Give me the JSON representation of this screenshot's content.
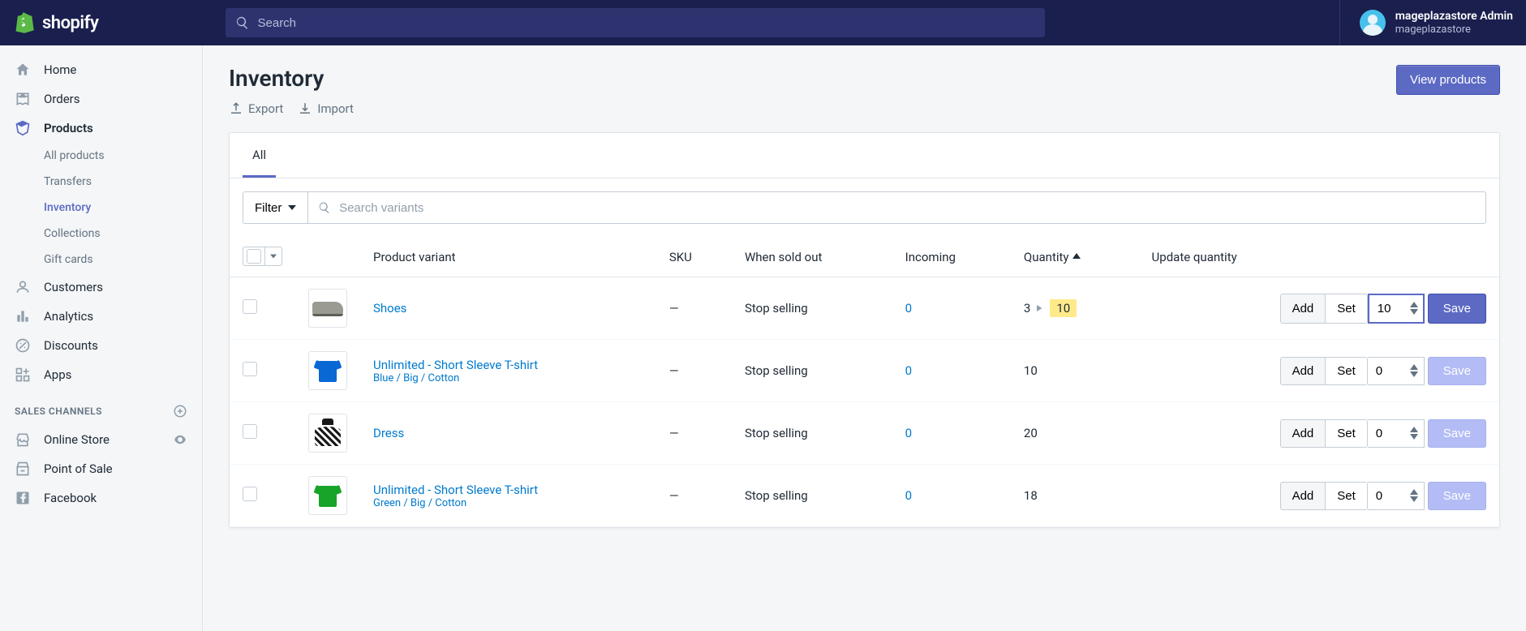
{
  "header": {
    "brand": "shopify",
    "search_placeholder": "Search",
    "user_name": "mageplazastore Admin",
    "user_store": "mageplazastore"
  },
  "sidebar": {
    "main": [
      {
        "label": "Home",
        "icon": "home"
      },
      {
        "label": "Orders",
        "icon": "orders"
      },
      {
        "label": "Products",
        "icon": "products",
        "active": true
      },
      {
        "label": "Customers",
        "icon": "customers"
      },
      {
        "label": "Analytics",
        "icon": "analytics"
      },
      {
        "label": "Discounts",
        "icon": "discounts"
      },
      {
        "label": "Apps",
        "icon": "apps"
      }
    ],
    "products_sub": [
      {
        "label": "All products"
      },
      {
        "label": "Transfers"
      },
      {
        "label": "Inventory",
        "active": true
      },
      {
        "label": "Collections"
      },
      {
        "label": "Gift cards"
      }
    ],
    "channels_header": "SALES CHANNELS",
    "channels": [
      {
        "label": "Online Store",
        "icon": "store",
        "eye": true
      },
      {
        "label": "Point of Sale",
        "icon": "pos"
      },
      {
        "label": "Facebook",
        "icon": "facebook"
      }
    ]
  },
  "page": {
    "title": "Inventory",
    "export": "Export",
    "import": "Import",
    "view_products": "View products",
    "tab_all": "All",
    "filter_label": "Filter",
    "search_variants_placeholder": "Search variants"
  },
  "columns": {
    "product": "Product variant",
    "sku": "SKU",
    "sold_out": "When sold out",
    "incoming": "Incoming",
    "quantity": "Quantity",
    "update": "Update quantity"
  },
  "btns": {
    "add": "Add",
    "set": "Set",
    "save": "Save"
  },
  "rows": [
    {
      "name": "Shoes",
      "sub": "",
      "sku": "—",
      "sold_out": "Stop selling",
      "incoming": "0",
      "qty_old": "3",
      "qty_new": "10",
      "input": "10",
      "focused": true,
      "active_seg": "add",
      "thumb": "shoe"
    },
    {
      "name": "Unlimited - Short Sleeve T-shirt",
      "sub": "Blue / Big / Cotton",
      "sku": "—",
      "sold_out": "Stop selling",
      "incoming": "0",
      "qty": "10",
      "input": "0",
      "active_seg": "add",
      "thumb": "tshirt-blue"
    },
    {
      "name": "Dress",
      "sub": "",
      "sku": "—",
      "sold_out": "Stop selling",
      "incoming": "0",
      "qty": "20",
      "input": "0",
      "active_seg": "add",
      "thumb": "dress"
    },
    {
      "name": "Unlimited - Short Sleeve T-shirt",
      "sub": "Green / Big / Cotton",
      "sku": "—",
      "sold_out": "Stop selling",
      "incoming": "0",
      "qty": "18",
      "input": "0",
      "active_seg": "add",
      "thumb": "tshirt-green"
    }
  ]
}
